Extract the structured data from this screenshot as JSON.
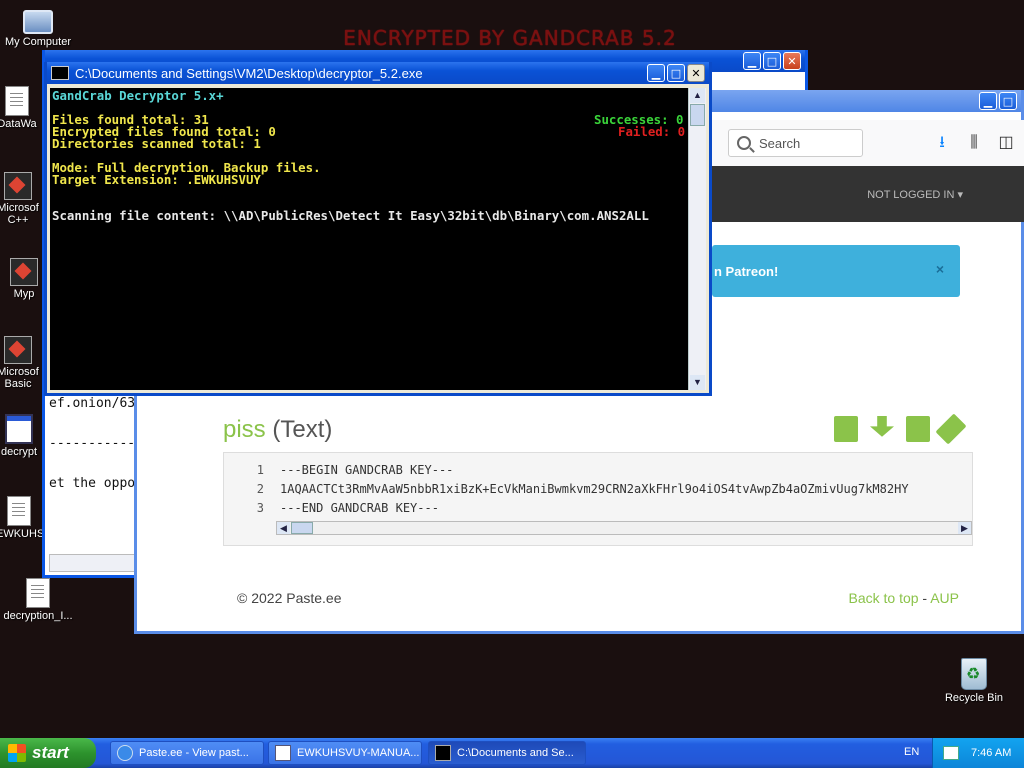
{
  "desktop": {
    "wallpaper_text": "ENCRYPTED BY GANDCRAB 5.2",
    "icons": [
      {
        "label": "My Computer",
        "icon": "computer-icon"
      },
      {
        "label": "DataWa",
        "icon": "document-icon"
      },
      {
        "label": "Microsof C++",
        "icon": "application-icon"
      },
      {
        "label": "Myp",
        "icon": "application-icon"
      },
      {
        "label": "Microsof Basic",
        "icon": "application-icon"
      },
      {
        "label": "decrypt",
        "icon": "window-icon"
      },
      {
        "label": "EWKUHS",
        "icon": "document-icon"
      },
      {
        "label": "decryption_I...",
        "icon": "document-icon"
      },
      {
        "label": "Recycle Bin",
        "icon": "recycle-bin-icon"
      }
    ]
  },
  "back_window": {
    "lines": [
      "ef.onion/63",
      "------------",
      "et the oppo"
    ]
  },
  "browser": {
    "search_placeholder": "Search",
    "nav_user": "NOT LOGGED IN ▾",
    "banner_text": "n Patreon!",
    "banner_close": "×",
    "paste_name": "piss",
    "paste_type": "(Text)",
    "code_lines": [
      {
        "n": "1",
        "text": "---BEGIN GANDCRAB KEY---"
      },
      {
        "n": "2",
        "text": "1AQAACTCt3RmMvAaW5nbbR1xiBzK+EcVkManiBwmkvm29CRN2aXkFHrl9o4iOS4tvAwpZb4aOZmivUug7kM82HY"
      },
      {
        "n": "3",
        "text": "---END GANDCRAB KEY---"
      }
    ],
    "footer_copyright": "© 2022 Paste.ee",
    "footer_back_to_top": "Back to top",
    "footer_sep": " - ",
    "footer_aup": "AUP"
  },
  "console_window": {
    "title": "C:\\Documents and Settings\\VM2\\Desktop\\decryptor_5.2.exe",
    "header": "GandCrab Decryptor 5.x+",
    "files_found": "Files found total: 31",
    "encrypted_found": "Encrypted files found total: 0",
    "dirs_scanned": "Directories scanned total: 1",
    "successes": "Successes: 0",
    "failed": "Failed: 0",
    "mode": "Mode: Full decryption. Backup files.",
    "target_ext": "Target Extension: .EWKUHSVUY",
    "scanning": "Scanning file content: \\\\AD\\PublicRes\\Detect It Easy\\32bit\\db\\Binary\\com.ANS2ALL"
  },
  "taskbar": {
    "start_label": "start",
    "tasks": [
      {
        "label": "Paste.ee - View past...",
        "icon": "internet-explorer-icon"
      },
      {
        "label": "EWKUHSVUY-MANUA...",
        "icon": "notepad-icon"
      },
      {
        "label": "C:\\Documents and Se...",
        "icon": "console-icon"
      }
    ],
    "language": "EN",
    "clock": "7:46 AM"
  },
  "colors": {
    "console_cyan": "#5ad7d7",
    "console_yellow": "#f0e64c",
    "console_green": "#3ad43a",
    "console_red": "#e02020",
    "paste_accent": "#8bc34a",
    "banner_blue": "#3eb0dc"
  }
}
